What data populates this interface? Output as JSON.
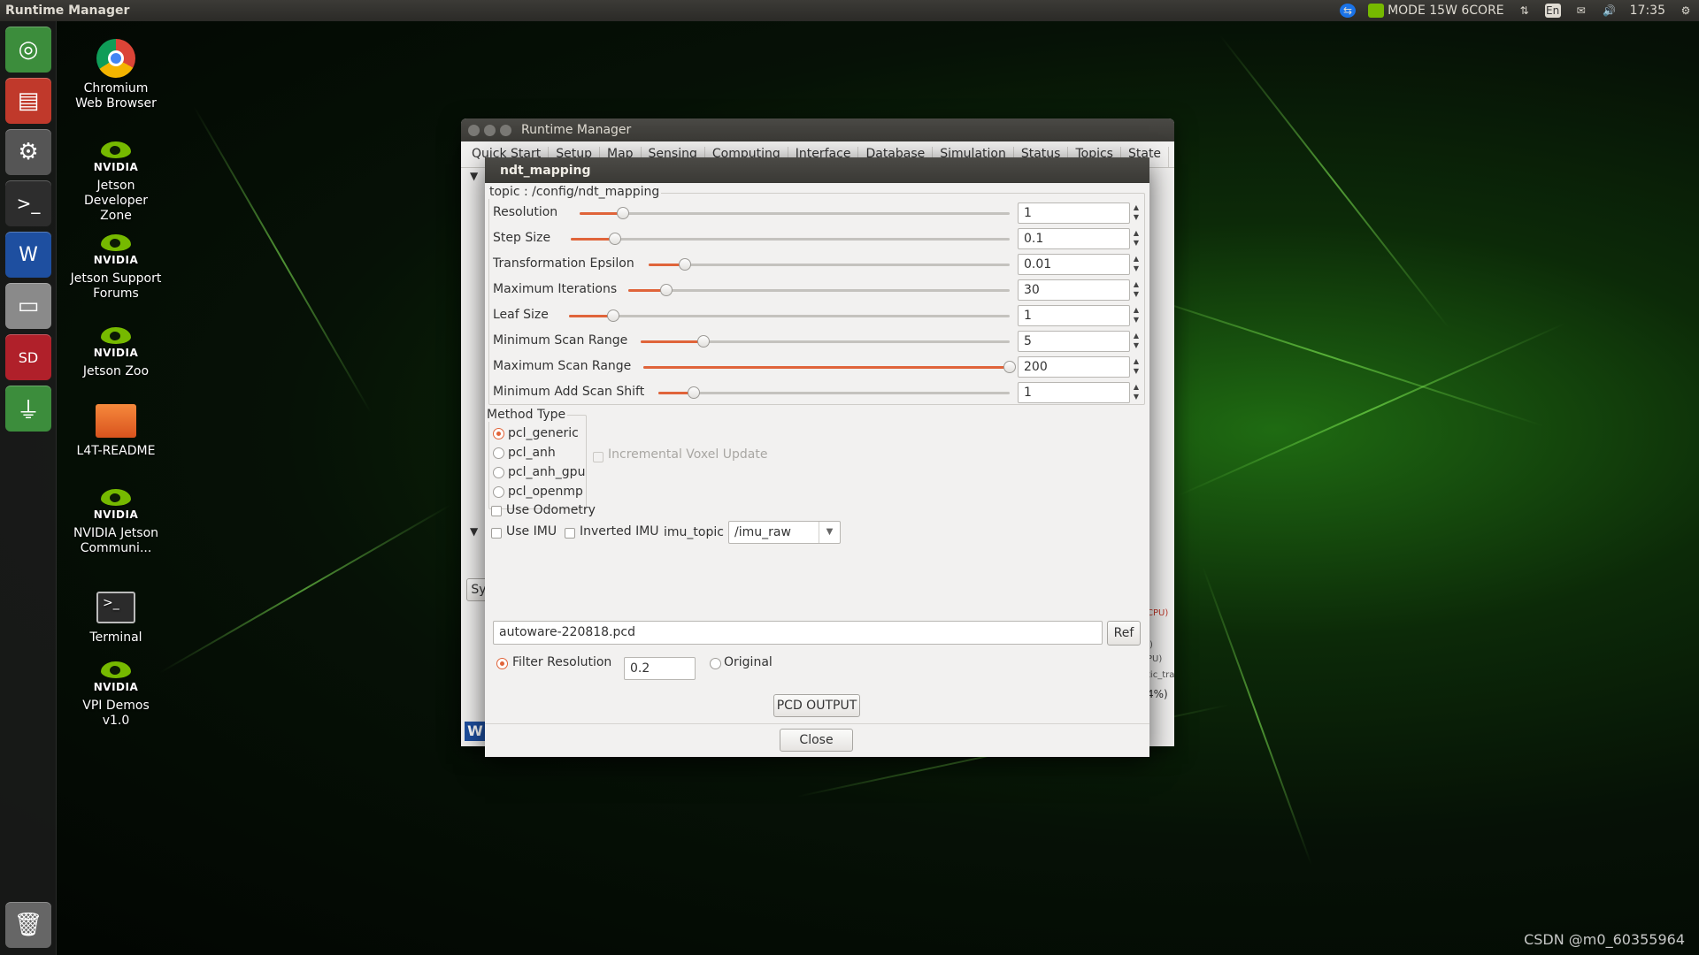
{
  "top_panel": {
    "app_title": "Runtime Manager",
    "power_mode": "MODE 15W 6CORE",
    "keyboard": "En",
    "time": "17:35"
  },
  "desktop_icons": [
    {
      "label": "Chromium Web Browser",
      "icon": "chromium-icon"
    },
    {
      "label": "Jetson Developer Zone",
      "icon": "nvidia-icon"
    },
    {
      "label": "Jetson Support Forums",
      "icon": "nvidia-icon"
    },
    {
      "label": "Jetson Zoo",
      "icon": "nvidia-icon"
    },
    {
      "label": "L4T-README",
      "icon": "folder-icon"
    },
    {
      "label": "NVIDIA Jetson Communi...",
      "icon": "nvidia-icon"
    },
    {
      "label": "Terminal",
      "icon": "terminal-icon"
    },
    {
      "label": "VPI Demos v1.0",
      "icon": "nvidia-icon"
    }
  ],
  "nvidia_logo_text": "NVIDIA",
  "background_window": {
    "title": "Runtime Manager",
    "tabs": [
      "Quick Start",
      "Setup",
      "Map",
      "Sensing",
      "Computing",
      "Interface",
      "Database",
      "Simulation",
      "Status",
      "Topics",
      "State"
    ],
    "partial_button": "Sy",
    "partial_texts": [
      "CPU)",
      ")",
      "PU)",
      "tic_tra",
      "4%)"
    ]
  },
  "dialog": {
    "title": "ndt_mapping",
    "topic_label": "topic : /config/ndt_mapping",
    "params": [
      {
        "label": "Resolution",
        "value": "1",
        "fraction": 0.1
      },
      {
        "label": "Step Size",
        "value": "0.1",
        "fraction": 0.1
      },
      {
        "label": "Transformation Epsilon",
        "value": "0.01",
        "fraction": 0.1
      },
      {
        "label": "Maximum Iterations",
        "value": "30",
        "fraction": 0.1
      },
      {
        "label": "Leaf Size",
        "value": "1",
        "fraction": 0.1
      },
      {
        "label": "Minimum Scan Range",
        "value": "5",
        "fraction": 0.17
      },
      {
        "label": "Maximum Scan Range",
        "value": "200",
        "fraction": 1.0
      },
      {
        "label": "Minimum Add Scan Shift",
        "value": "1",
        "fraction": 0.1
      }
    ],
    "method_type_label": "Method Type",
    "methods": [
      "pcl_generic",
      "pcl_anh",
      "pcl_anh_gpu",
      "pcl_openmp"
    ],
    "selected_method": "pcl_generic",
    "incremental_voxel_label": "Incremental Voxel Update",
    "use_odometry_label": "Use Odometry",
    "use_imu_label": "Use IMU",
    "inverted_imu_label": "Inverted IMU",
    "imu_topic_label": "imu_topic",
    "imu_topic_value": "/imu_raw",
    "pcd_file": "autoware-220818.pcd",
    "ref_label": "Ref",
    "filter_resolution_label": "Filter Resolution",
    "filter_resolution_value": "0.2",
    "original_label": "Original",
    "pcd_output_label": "PCD OUTPUT",
    "close_label": "Close"
  },
  "watermark": "CSDN @m0_60355964",
  "accent_color": "#e0643a"
}
